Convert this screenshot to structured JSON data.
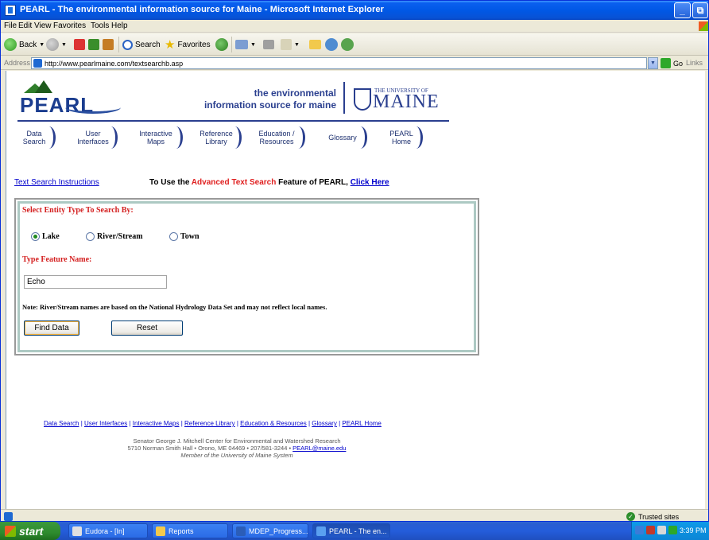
{
  "window": {
    "title": "PEARL - The environmental information source for Maine - Microsoft Internet Explorer",
    "minimize_label": "_",
    "maximize_label": "⧉"
  },
  "menu": [
    "File",
    "Edit",
    "View",
    "Favorites",
    "Tools",
    "Help"
  ],
  "toolbar": {
    "back": "Back",
    "search": "Search",
    "favorites": "Favorites"
  },
  "address": {
    "label": "Address",
    "url": "http://www.pearlmaine.com/textsearchb.asp",
    "go": "Go",
    "links": "Links"
  },
  "header": {
    "logo": "PEARL",
    "tagline_line1": "the environmental",
    "tagline_line2": "information source for maine",
    "umaine_small": "THE UNIVERSITY OF",
    "umaine_big": "MAINE"
  },
  "nav": [
    {
      "line1": "Data",
      "line2": "Search"
    },
    {
      "line1": "User",
      "line2": "Interfaces"
    },
    {
      "line1": "Interactive",
      "line2": "Maps"
    },
    {
      "line1": "Reference",
      "line2": "Library"
    },
    {
      "line1": "Education /",
      "line2": "Resources"
    },
    {
      "line1": "Glossary",
      "line2": ""
    },
    {
      "line1": "PEARL",
      "line2": "Home"
    }
  ],
  "search": {
    "instructions_link": "Text Search Instructions",
    "advanced_prefix": "To Use the ",
    "advanced_red": "Advanced Text Search",
    "advanced_suffix": " Feature of PEARL, ",
    "advanced_link": "Click Here",
    "entity_heading": "Select Entity Type To Search By:",
    "entity_options": [
      "Lake",
      "River/Stream",
      "Town"
    ],
    "selected_entity": "Lake",
    "feature_heading": "Type Feature Name:",
    "feature_value": "Echo",
    "note": "Note: River/Stream names are based on the National Hydrology Data Set and may not reflect local names.",
    "find_button": "Find Data",
    "reset_button": "Reset"
  },
  "footer": {
    "links": [
      "Data Search",
      "User Interfaces",
      "Interactive Maps",
      "Reference Library",
      "Education & Resources",
      "Glossary",
      "PEARL Home"
    ],
    "separator": " | ",
    "line1": "Senator George J. Mitchell Center for Environmental and Watershed Research",
    "line2_prefix": "5710 Norman Smith Hall • Orono, ME 04469 • 207/581-3244 • ",
    "email": "PEARL@maine.edu",
    "line3": "Member of the University of Maine System"
  },
  "status": {
    "zone": "Trusted sites"
  },
  "taskbar": {
    "start": "start",
    "tasks": [
      {
        "label": "Eudora - [In]",
        "color": "#E0E0E0",
        "active": false
      },
      {
        "label": "Reports",
        "color": "#F2C94C",
        "active": false
      },
      {
        "label": "MDEP_Progress...",
        "color": "#2B5DB8",
        "active": false
      },
      {
        "label": "PEARL - The en...",
        "color": "#5AA0F0",
        "active": true
      }
    ],
    "clock": "3:39 PM"
  },
  "colors": {
    "accent_red": "#D42020",
    "link_blue": "#0000CC",
    "brand_navy": "#2A3F8F"
  }
}
